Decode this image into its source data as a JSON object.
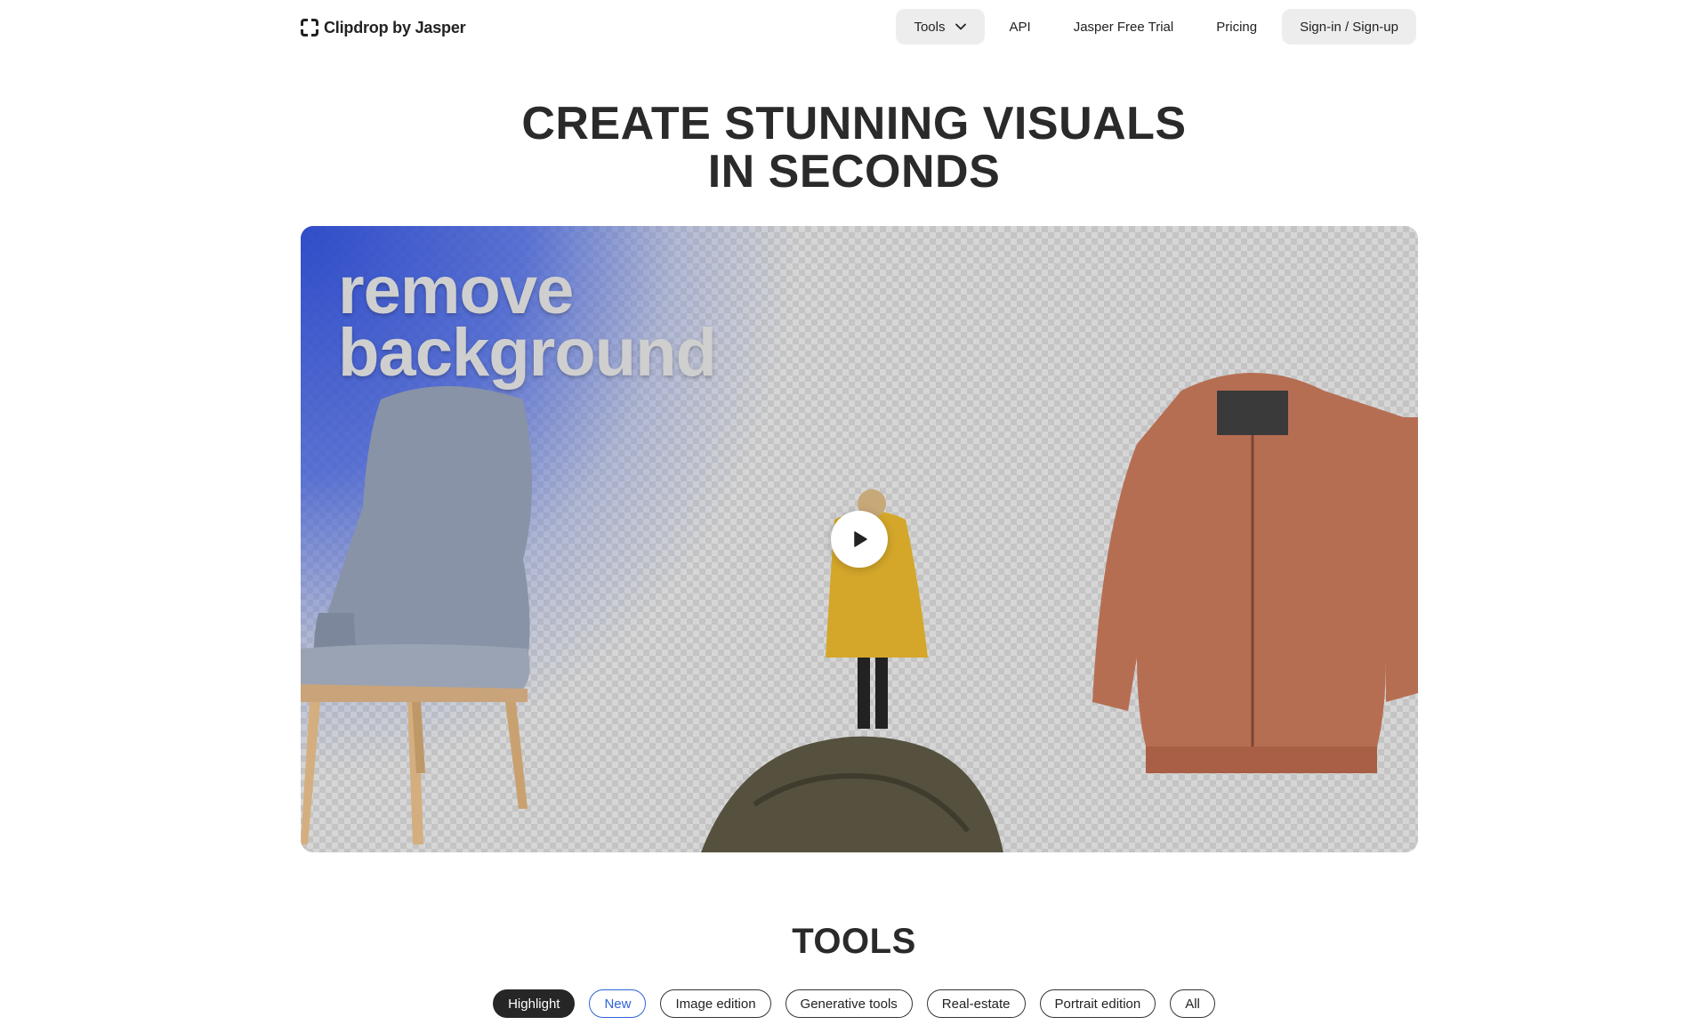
{
  "header": {
    "logo_text": "Clipdrop by Jasper",
    "nav": {
      "tools": "Tools",
      "api": "API",
      "jasper_trial": "Jasper Free Trial",
      "pricing": "Pricing",
      "signin": "Sign-in / Sign-up"
    }
  },
  "hero": {
    "title_line1": "CREATE STUNNING VISUALS",
    "title_line2": "IN SECONDS",
    "caption_line1": "remove",
    "caption_line2": "background",
    "play_icon": "play-icon"
  },
  "tools_section": {
    "title": "TOOLS",
    "filters": [
      "Highlight",
      "New",
      "Image edition",
      "Generative tools",
      "Real-estate",
      "Portrait edition",
      "All"
    ]
  },
  "colors": {
    "accent_blue": "#2f63d6",
    "dark": "#262626",
    "nav_bg": "#ededed"
  }
}
